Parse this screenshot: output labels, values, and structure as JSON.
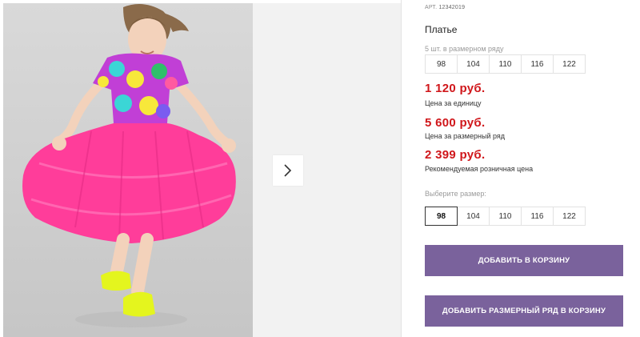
{
  "product": {
    "sku_label": "АРТ.",
    "sku": "12342019",
    "title": "Платье",
    "set_caption": "5 шт. в размерном ряду",
    "set_sizes": [
      "98",
      "104",
      "110",
      "116",
      "122"
    ],
    "prices": [
      {
        "value": "1 120 руб.",
        "note": "Цена за единицу"
      },
      {
        "value": "5 600 руб.",
        "note": "Цена за размерный ряд"
      },
      {
        "value": "2 399 руб.",
        "note": "Рекомендуемая розничная цена"
      }
    ],
    "choose_caption": "Выберите размер:",
    "selectable_sizes": [
      "98",
      "104",
      "110",
      "116",
      "122"
    ],
    "selected_size": "98"
  },
  "actions": {
    "add_to_cart": "ДОБАВИТЬ В КОРЗИНУ",
    "add_set_to_cart": "ДОБАВИТЬ РАЗМЕРНЫЙ РЯД В КОРЗИНУ"
  },
  "gallery": {
    "next_icon": "chevron-right-icon"
  },
  "colors": {
    "price": "#d0171b",
    "button": "#7a629c",
    "dress_skirt": "#ff3d9a",
    "shoes": "#e4f51e"
  }
}
